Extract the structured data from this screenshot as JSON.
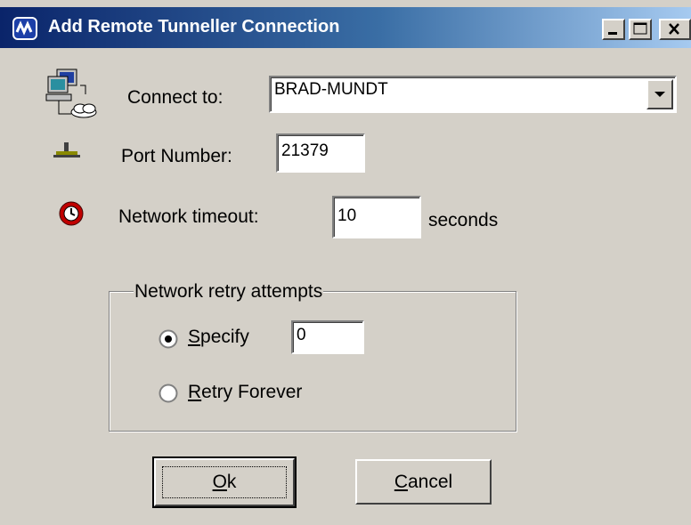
{
  "window": {
    "title": "Add Remote Tunneller Connection",
    "title_icon": "tunneller-app-icon"
  },
  "title_buttons": {
    "minimize": "minimize-icon",
    "maximize": "maximize-icon",
    "close": "close-icon"
  },
  "connect": {
    "label": "Connect to:",
    "icon": "network-computer-icon",
    "value": "BRAD-MUNDT"
  },
  "port": {
    "label": "Port Number:",
    "icon": "network-port-icon",
    "value": "21379"
  },
  "timeout": {
    "label": "Network timeout:",
    "icon": "clock-icon",
    "value": "10",
    "unit": "seconds"
  },
  "retry": {
    "group_label": "Network retry attempts",
    "specify": {
      "label_first": "S",
      "label_rest": "pecify",
      "selected": true,
      "value": "0"
    },
    "forever": {
      "label_first": "R",
      "label_rest": "etry Forever",
      "selected": false
    }
  },
  "buttons": {
    "ok": {
      "label_first": "O",
      "label_rest": "k"
    },
    "cancel": {
      "label_first": "C",
      "label_rest": "ancel"
    }
  },
  "colors": {
    "titlebar_start": "#0a246a",
    "titlebar_end": "#a6caf0",
    "dialog_face": "#d4d0c8"
  }
}
